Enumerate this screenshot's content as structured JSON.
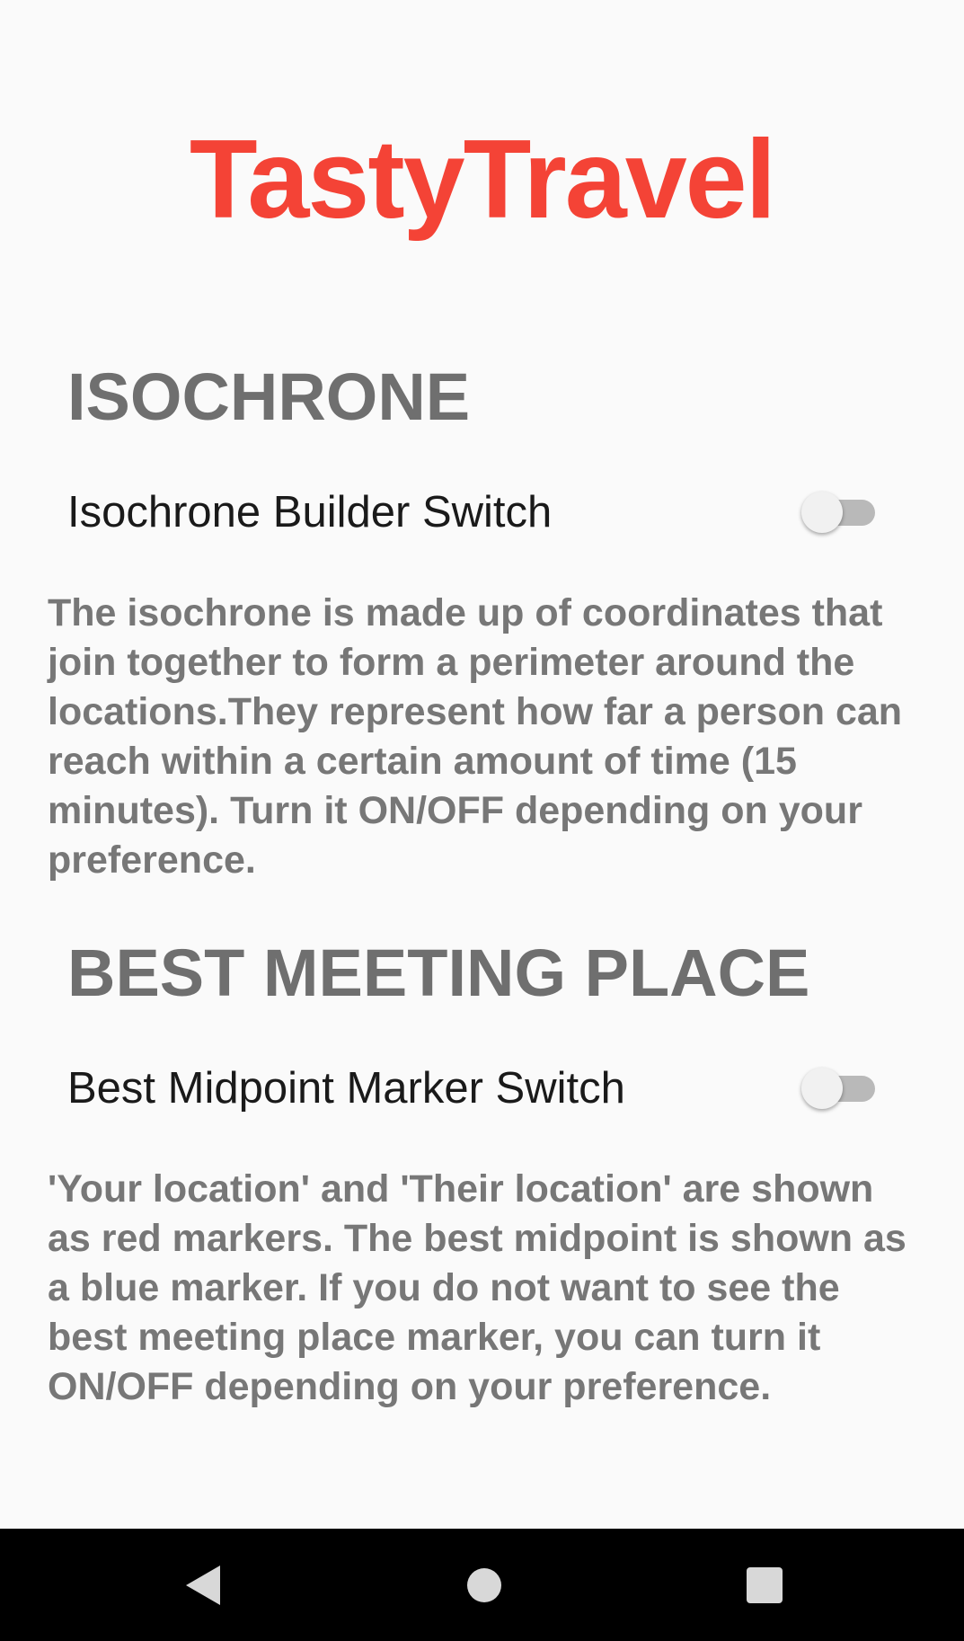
{
  "app": {
    "title": "TastyTravel",
    "title_color": "#f44336"
  },
  "isochrone": {
    "heading": "ISOCHRONE",
    "switch_label": "Isochrone Builder Switch",
    "switch_on": false,
    "description": "The isochrone is made up of coordinates that join together to form a perimeter around the locations.They represent how far a person can reach within a certain amount of time (15 minutes). Turn it ON/OFF depending on your preference."
  },
  "best_meeting_place": {
    "heading": "BEST MEETING PLACE",
    "switch_label": "Best Midpoint Marker Switch",
    "switch_on": false,
    "description": "'Your location' and 'Their location' are shown as red markers. The best midpoint is shown as a blue marker. If you do not want to see the best meeting place marker, you can turn it ON/OFF depending on your preference."
  },
  "navigation_bar": {
    "buttons": [
      {
        "icon": "back-icon"
      },
      {
        "icon": "home-icon"
      },
      {
        "icon": "recents-icon"
      }
    ]
  }
}
